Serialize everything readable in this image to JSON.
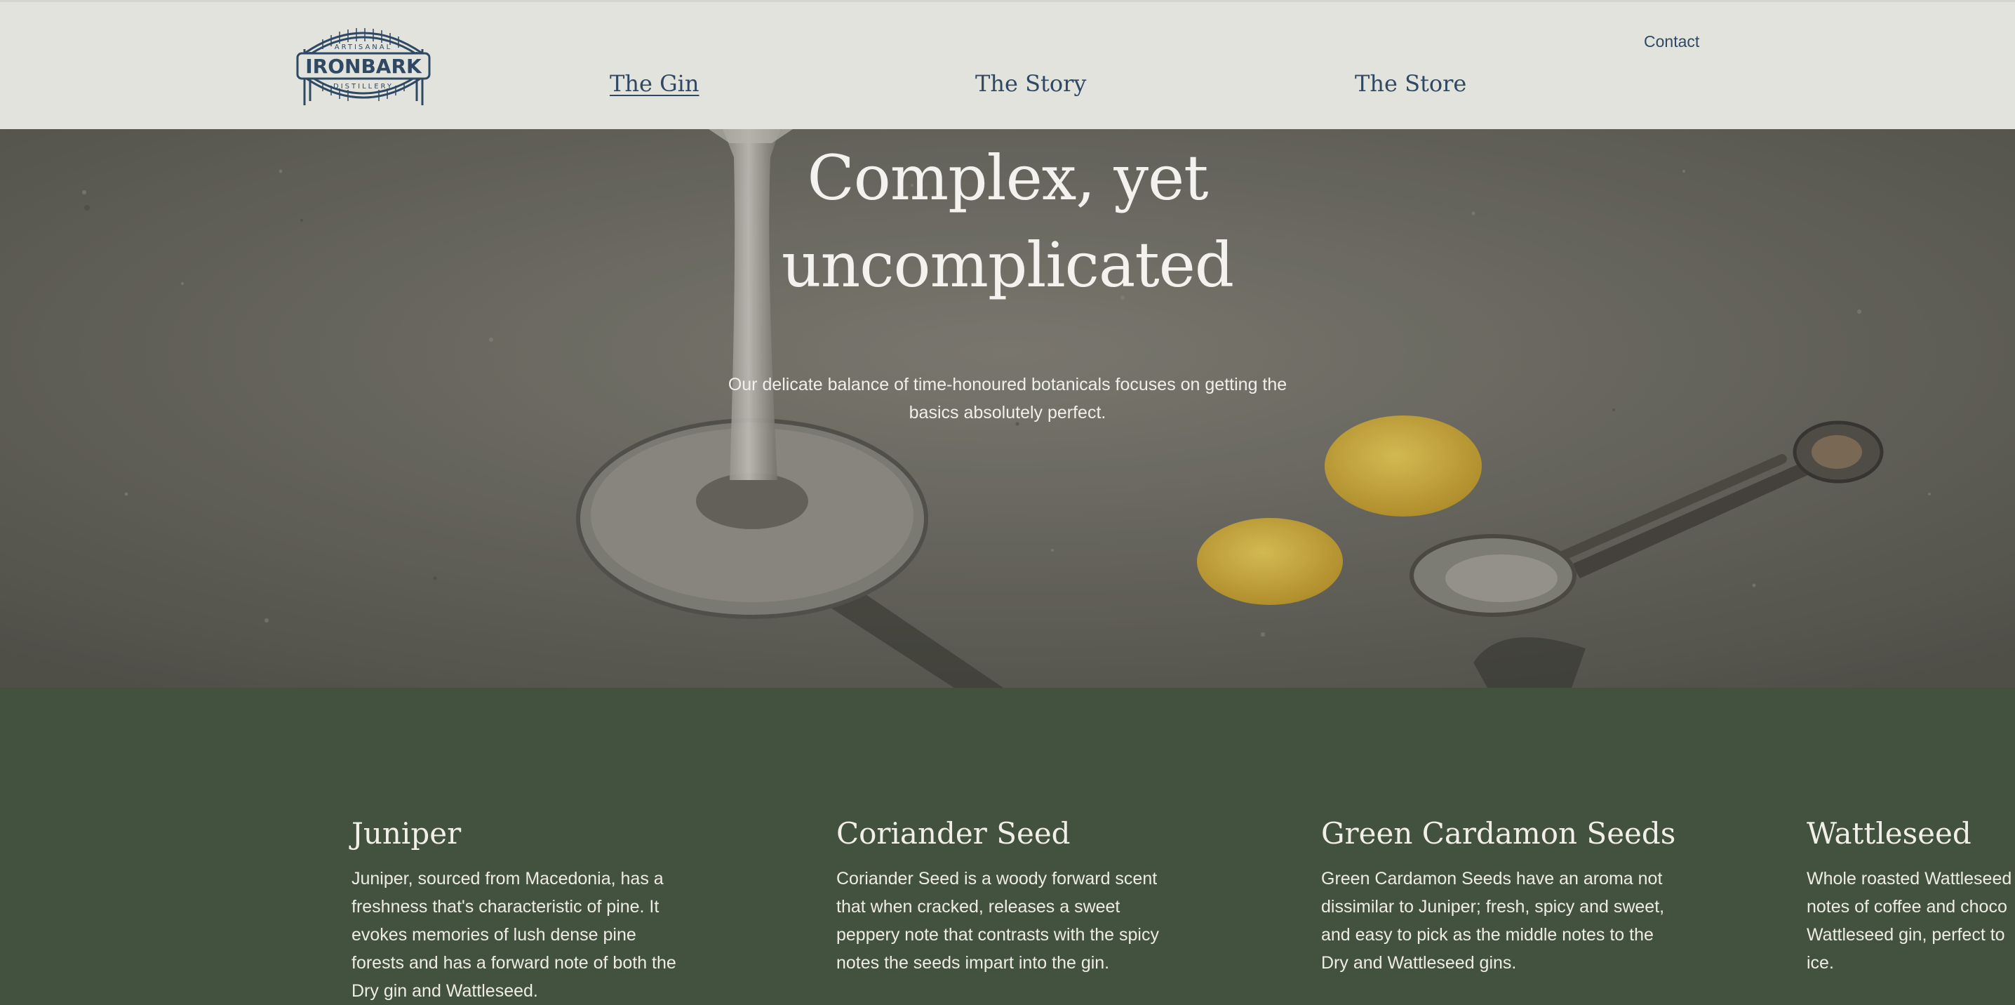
{
  "brand": {
    "logo_top": "ARTISANAL",
    "logo_name": "IRONBARK",
    "logo_bottom": "DISTILLERY",
    "color": "#2f4863"
  },
  "nav": {
    "items": [
      {
        "label": "The Gin",
        "active": true
      },
      {
        "label": "The Story",
        "active": false
      },
      {
        "label": "The Store",
        "active": false
      }
    ],
    "contact": "Contact"
  },
  "hero": {
    "title_line1": "Complex, yet",
    "title_line2": "uncomplicated",
    "subtitle_line1": "Our delicate balance of time-honoured botanicals focuses on getting the",
    "subtitle_line2": "basics absolutely perfect."
  },
  "botanicals": [
    {
      "name": "Juniper",
      "description": "Juniper, sourced from Macedonia, has a freshness that's characteristic of pine. It evokes memories of lush dense pine forests and has a forward note of both the Dry gin and Wattleseed."
    },
    {
      "name": "Coriander Seed",
      "description": "Coriander Seed is a woody forward scent that when cracked, releases a sweet peppery note that contrasts with the spicy notes the seeds impart into the gin."
    },
    {
      "name": "Green Cardamon Seeds",
      "description": "Green Cardamon Seeds have an aroma not dissimilar to Juniper; fresh, spicy and sweet, and easy to pick as the middle notes to the Dry and Wattleseed gins."
    },
    {
      "name": "Wattleseed",
      "description": "Whole roasted Wattleseed notes of coffee and choco Wattleseed gin, perfect to ice."
    }
  ],
  "colors": {
    "header_bg": "#e2e3dc",
    "nav_text": "#2f4863",
    "section_bg": "#43523e",
    "lemon": "#e3c24a"
  }
}
